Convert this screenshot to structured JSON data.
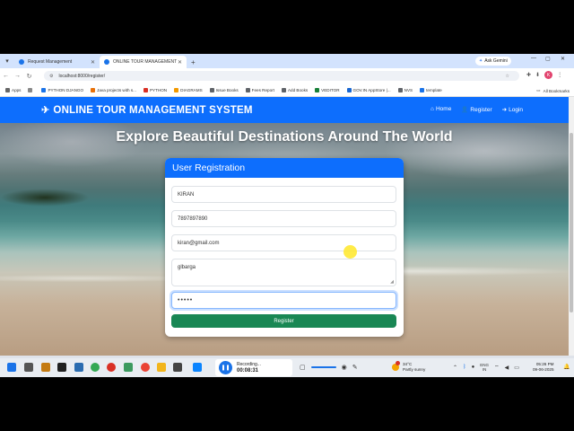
{
  "browser": {
    "tabs": [
      {
        "label": "Request Management"
      },
      {
        "label": "ONLINE TOUR MANAGEMENT"
      }
    ],
    "ask_gemini": "Ask Gemini",
    "url": "localhost:8000/register/",
    "profile_initial": "K",
    "bookmarks": [
      "Apps",
      "PYTHON DJANGO",
      "Java projects with s...",
      "PYTHON",
      "DIAGRAMS",
      "Issue Books",
      "Fees Report",
      "Add Books",
      "VEDITOR",
      "GOV.IN AppStore |...",
      "NVS",
      "template"
    ],
    "all_bookmarks": "All Bookmarks"
  },
  "site": {
    "brand": "ONLINE TOUR MANAGEMENT SYSTEM",
    "nav": [
      {
        "label": "Home"
      },
      {
        "label": "Register"
      },
      {
        "label": "Login"
      }
    ],
    "headline": "Explore Beautiful Destinations Around The World"
  },
  "form": {
    "title": "User Registration",
    "name_value": "KIRAN",
    "phone_value": "7897897890",
    "email_value": "kiran@gmail.com",
    "address_value": "glbarga",
    "password_mask": "•••••",
    "submit_label": "Register"
  },
  "taskbar": {
    "recording_label": "Recording...",
    "recording_time": "00:08:31",
    "weather_temp": "34°C",
    "weather_desc": "Partly sunny",
    "lang_top": "ENG",
    "lang_bottom": "IN",
    "time": "05:26 PM",
    "date": "09-06-2025"
  },
  "colors": {
    "primary": "#0d6efd",
    "success": "#198754"
  }
}
